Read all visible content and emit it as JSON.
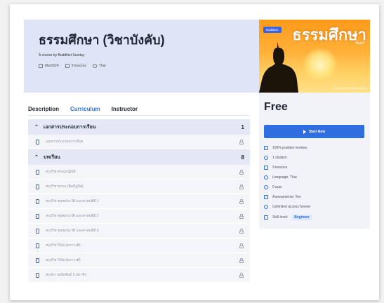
{
  "course": {
    "title": "ธรรมศึกษา (วิชาบังคับ)",
    "author_line": "A course by Buddhist Sunday",
    "date": "Mar2024",
    "lessons": "9 lessons",
    "language": "Thai"
  },
  "tabs": [
    {
      "label": "Description",
      "active": false
    },
    {
      "label": "Curriculum",
      "active": true
    },
    {
      "label": "Instructor",
      "active": false
    }
  ],
  "curriculum": {
    "sections": [
      {
        "title": "เอกสารประกอบการเรียน",
        "count": "1",
        "lessons": [
          "เอกสารประกอบการเรียน"
        ]
      },
      {
        "title": "บทเรียน",
        "count": "8",
        "lessons": [
          "สรุปวิชาธรรมปฏิบัติ",
          "สรุปวิชาธรรม (ติดปิฎกิต)",
          "สรุปวิชาพุทธประวัติ และศาสนพิธี 1",
          "สรุปวิชาพุทธประวัติ และศาสนพิธี 2",
          "สรุปวิชาพุทธประวัติ และศาสนพิธี 3",
          "สรุปวิชาวินัย (มหาวงศ์)",
          "สรุปวิชาวินัย (มหาวงศ์)",
          "สรุปความสัมพันธ์ 2 สมาชิก"
        ]
      }
    ]
  },
  "thumbnail": {
    "badge": "Buddism",
    "title": "ธรรมศึกษา",
    "subtitle": "ชั้นตรี",
    "footer": "วันอาทิตย์สร้างคนดีประเทศไทย"
  },
  "sidebar": {
    "price": "Free",
    "start_label": "Start Now",
    "features": [
      {
        "icon": "thumbs-up-icon",
        "text": "100% positive reviews"
      },
      {
        "icon": "user-icon",
        "text": "1 student"
      },
      {
        "icon": "lessons-icon",
        "text": "9 lessons"
      },
      {
        "icon": "globe-icon",
        "text": "Language: Thai"
      },
      {
        "icon": "quiz-icon",
        "text": "0 quiz"
      },
      {
        "icon": "pencil-icon",
        "text": "Assessments: Yes"
      },
      {
        "icon": "infinity-icon",
        "text": "Unlimited access forever"
      },
      {
        "icon": "bar-chart-icon",
        "text": "Skill level:",
        "badge": "Beginner"
      }
    ]
  },
  "colors": {
    "accent": "#2e6ee0",
    "hero_bg": "#dfe4f6",
    "section_bg": "#e4e8f4"
  }
}
